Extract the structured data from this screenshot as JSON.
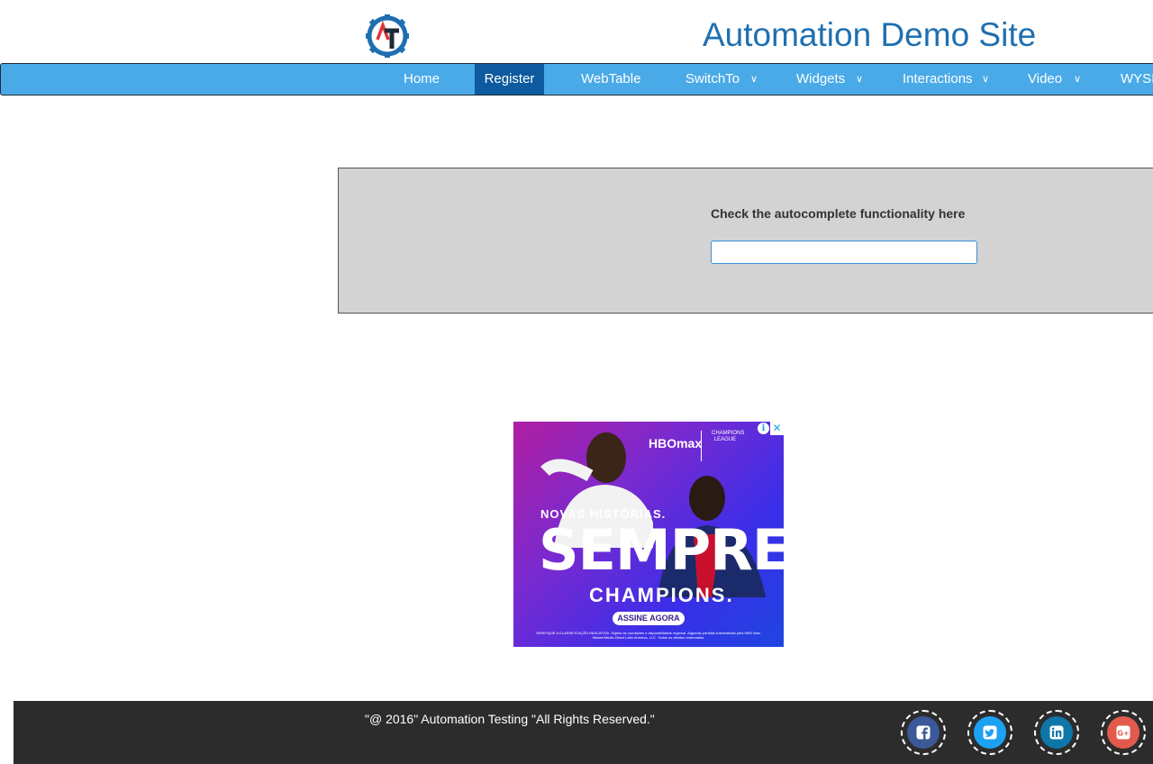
{
  "header": {
    "site_title": "Automation Demo Site",
    "logo_text": "AT"
  },
  "nav": {
    "items": [
      {
        "label": "Home",
        "active": false,
        "dropdown": false
      },
      {
        "label": "Register",
        "active": true,
        "dropdown": false
      },
      {
        "label": "WebTable",
        "active": false,
        "dropdown": false
      },
      {
        "label": "SwitchTo",
        "active": false,
        "dropdown": true
      },
      {
        "label": "Widgets",
        "active": false,
        "dropdown": true
      },
      {
        "label": "Interactions",
        "active": false,
        "dropdown": true
      },
      {
        "label": "Video",
        "active": false,
        "dropdown": true
      },
      {
        "label": "WYSIWYG",
        "active": false,
        "dropdown": false
      }
    ]
  },
  "autocomplete": {
    "label": "Check the autocomplete functionality here",
    "value": "",
    "placeholder": ""
  },
  "ad": {
    "brand": "HBOmax",
    "league": "CHAMPIONS LEAGUE",
    "tagline": "NOVAS HISTÓRIAS.",
    "headline": "SEMPRE",
    "subheadline": "CHAMPIONS.",
    "cta": "ASSINE AGORA",
    "fine_print": "VERIFIQUE A CLASSIFICAÇÃO INDICATIVA. Sujeito às condições e disponibilidade regional. Algumas partidas transmitidas pela HBO Max. WarnerMedia Direct Latin America, LLC. Todos os direitos reservados.",
    "info_icon": "info-icon",
    "close_icon": "close-icon"
  },
  "footer": {
    "copyright": "\"@ 2016\" Automation Testing \"All Rights Reserved.\"",
    "social": [
      {
        "name": "facebook",
        "color": "#3b5998"
      },
      {
        "name": "twitter",
        "color": "#1da1f2"
      },
      {
        "name": "linkedin",
        "color": "#0e76a8"
      },
      {
        "name": "google-plus",
        "color": "#e25a4b"
      }
    ]
  },
  "colors": {
    "nav_bg": "#4aaae8",
    "nav_active": "#0d5a9e",
    "title": "#1f6fb0",
    "panel_bg": "#d3d3d3",
    "footer_bg": "#2c2c2c"
  }
}
